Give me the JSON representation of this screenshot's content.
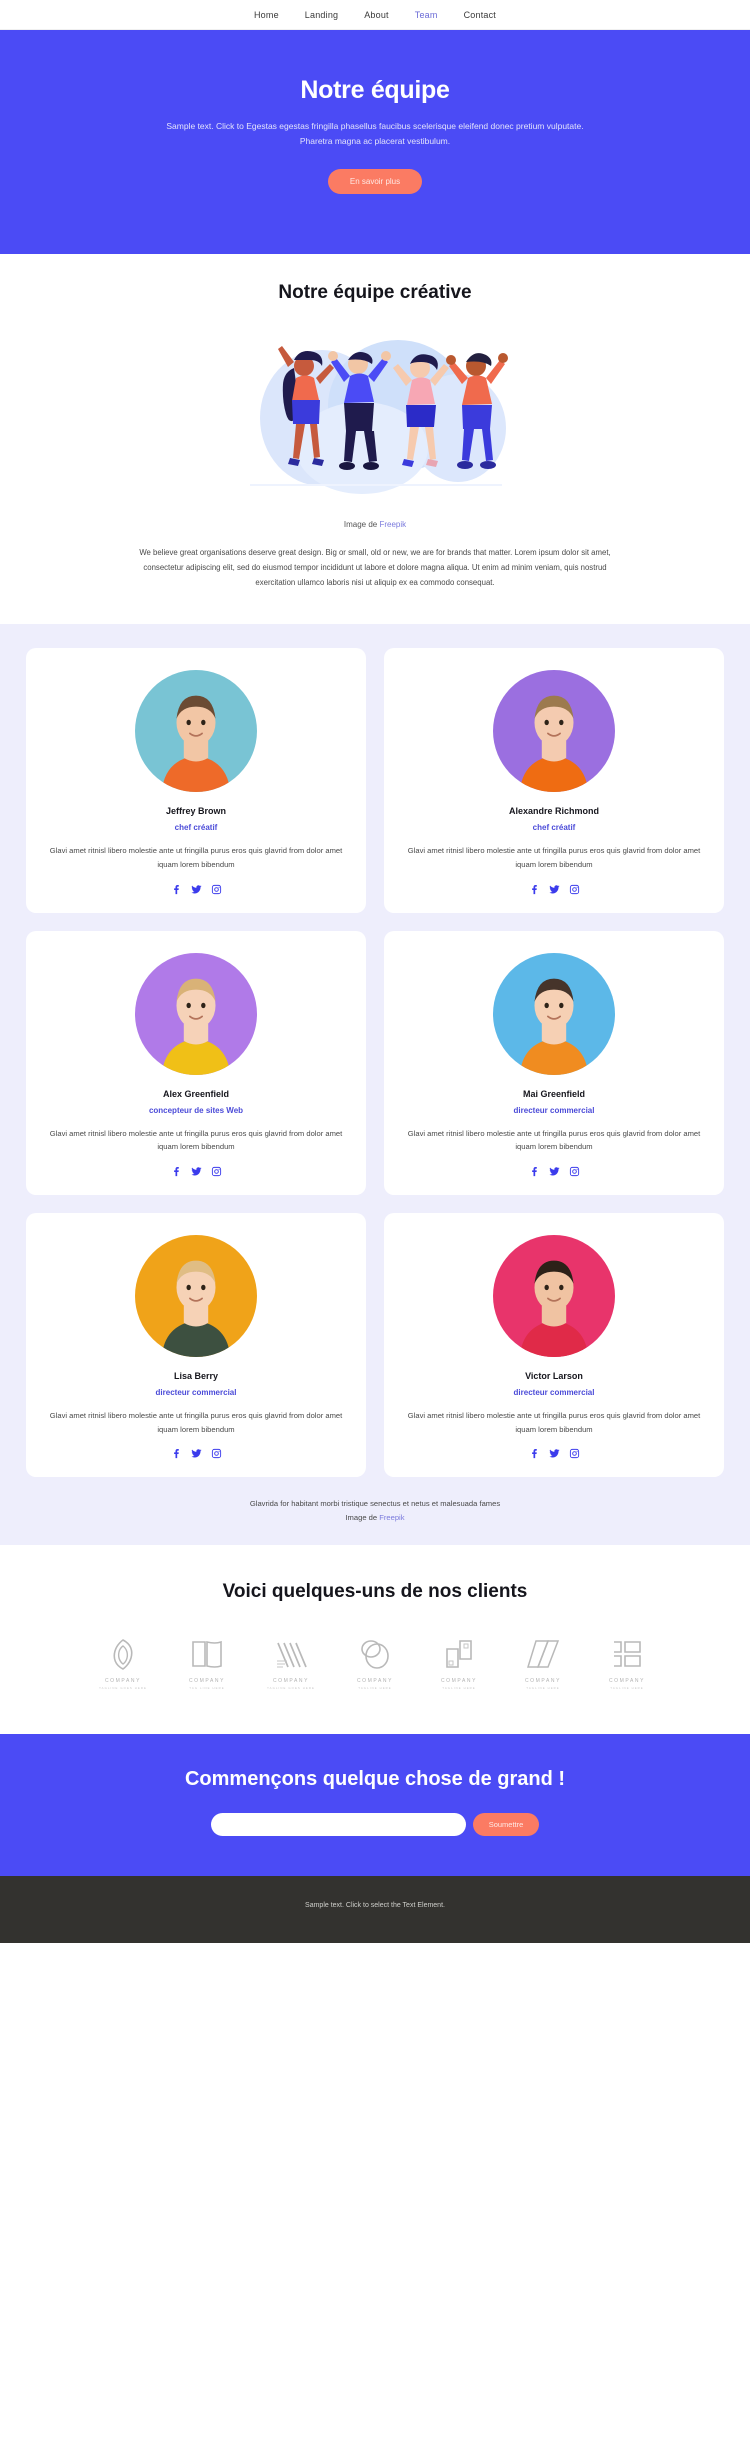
{
  "nav": {
    "items": [
      {
        "label": "Home",
        "active": false
      },
      {
        "label": "Landing",
        "active": false
      },
      {
        "label": "About",
        "active": false
      },
      {
        "label": "Team",
        "active": true
      },
      {
        "label": "Contact",
        "active": false
      }
    ]
  },
  "hero": {
    "title": "Notre équipe",
    "subtitle": "Sample text. Click to Egestas egestas fringilla phasellus faucibus scelerisque eleifend donec pretium vulputate. Pharetra magna ac placerat vestibulum.",
    "cta_label": "En savoir plus",
    "bg_color": "#4b4bf5",
    "button_color": "#fb7b63"
  },
  "creative": {
    "heading": "Notre équipe créative",
    "credit_prefix": "Image de ",
    "credit_link": "Freepik",
    "paragraph": "We believe great organisations deserve great design. Big or small, old or new, we are for brands that matter. Lorem ipsum dolor sit amet, consectetur adipiscing elit, sed do eiusmod tempor incididunt ut labore et dolore magna aliqua. Ut enim ad minim veniam, quis nostrud exercitation ullamco laboris nisi ut aliquip ex ea commodo consequat."
  },
  "team": {
    "bg_color": "#eeeefc",
    "role_color": "#4b4bd8",
    "members": [
      {
        "name": "Jeffrey Brown",
        "role": "chef créatif",
        "bio": "Glavi amet ritnisl libero molestie ante ut fringilla purus eros quis glavrid from dolor amet iquam lorem bibendum",
        "photo_bg": "#79c4d4",
        "shirt": "#ee6a29",
        "skin": "#f2c6a5",
        "hair": "#6b4b33"
      },
      {
        "name": "Alexandre Richmond",
        "role": "chef créatif",
        "bio": "Glavi amet ritnisl libero molestie ante ut fringilla purus eros quis glavrid from dolor amet iquam lorem bibendum",
        "photo_bg": "#9b6fe0",
        "shirt": "#ef6c12",
        "skin": "#f4cbb0",
        "hair": "#9c7a4e"
      },
      {
        "name": "Alex Greenfield",
        "role": "concepteur de sites Web",
        "bio": "Glavi amet ritnisl libero molestie ante ut fringilla purus eros quis glavrid from dolor amet iquam lorem bibendum",
        "photo_bg": "#b07ae8",
        "shirt": "#f0c017",
        "skin": "#f6d2b8",
        "hair": "#d9b277"
      },
      {
        "name": "Mai Greenfield",
        "role": "directeur commercial",
        "bio": "Glavi amet ritnisl libero molestie ante ut fringilla purus eros quis glavrid from dolor amet iquam lorem bibendum",
        "photo_bg": "#5cb8e8",
        "shirt": "#f08c20",
        "skin": "#f6d0b4",
        "hair": "#46342a"
      },
      {
        "name": "Lisa Berry",
        "role": "directeur commercial",
        "bio": "Glavi amet ritnisl libero molestie ante ut fringilla purus eros quis glavrid from dolor amet iquam lorem bibendum",
        "photo_bg": "#f0a319",
        "shirt": "#3d5040",
        "skin": "#f6d2b6",
        "hair": "#e0bd84"
      },
      {
        "name": "Victor Larson",
        "role": "directeur commercial",
        "bio": "Glavi amet ritnisl libero molestie ante ut fringilla purus eros quis glavrid from dolor amet iquam lorem bibendum",
        "photo_bg": "#e8346b",
        "shirt": "#e02a48",
        "skin": "#f0c3a2",
        "hair": "#2c2118"
      }
    ],
    "socials": [
      "facebook-icon",
      "twitter-icon",
      "instagram-icon"
    ],
    "footnote": "Glavrida for habitant morbi tristique senectus et netus et malesuada fames",
    "footnote_credit_prefix": "Image de ",
    "footnote_credit_link": "Freepik"
  },
  "clients": {
    "heading": "Voici quelques-uns de nos clients",
    "logos": [
      {
        "name": "COMPANY",
        "tagline": "TAGLINE GOES HERE",
        "mark": "leaf-ring-mark"
      },
      {
        "name": "COMPANY",
        "tagline": "TAG LINE HERE",
        "mark": "open-book-mark"
      },
      {
        "name": "COMPANY",
        "tagline": "TAGLINE GOES HERE",
        "mark": "chevron-lines-mark"
      },
      {
        "name": "COMPANY",
        "tagline": "TAGLINE HERE",
        "mark": "double-circle-mark"
      },
      {
        "name": "COMPANY",
        "tagline": "TAGLINE HERE",
        "mark": "squares-mark"
      },
      {
        "name": "COMPANY",
        "tagline": "TAGLINE HERE",
        "mark": "slash-lines-mark"
      },
      {
        "name": "COMPANY",
        "tagline": "TAGLINE HERE",
        "mark": "bracket-blocks-mark"
      }
    ]
  },
  "cta": {
    "heading": "Commençons quelque chose de grand !",
    "input_value": "",
    "input_placeholder": "",
    "submit_label": "Soumettre"
  },
  "footer": {
    "text": "Sample text. Click to select the Text Element.",
    "bg_color": "#33322f"
  }
}
